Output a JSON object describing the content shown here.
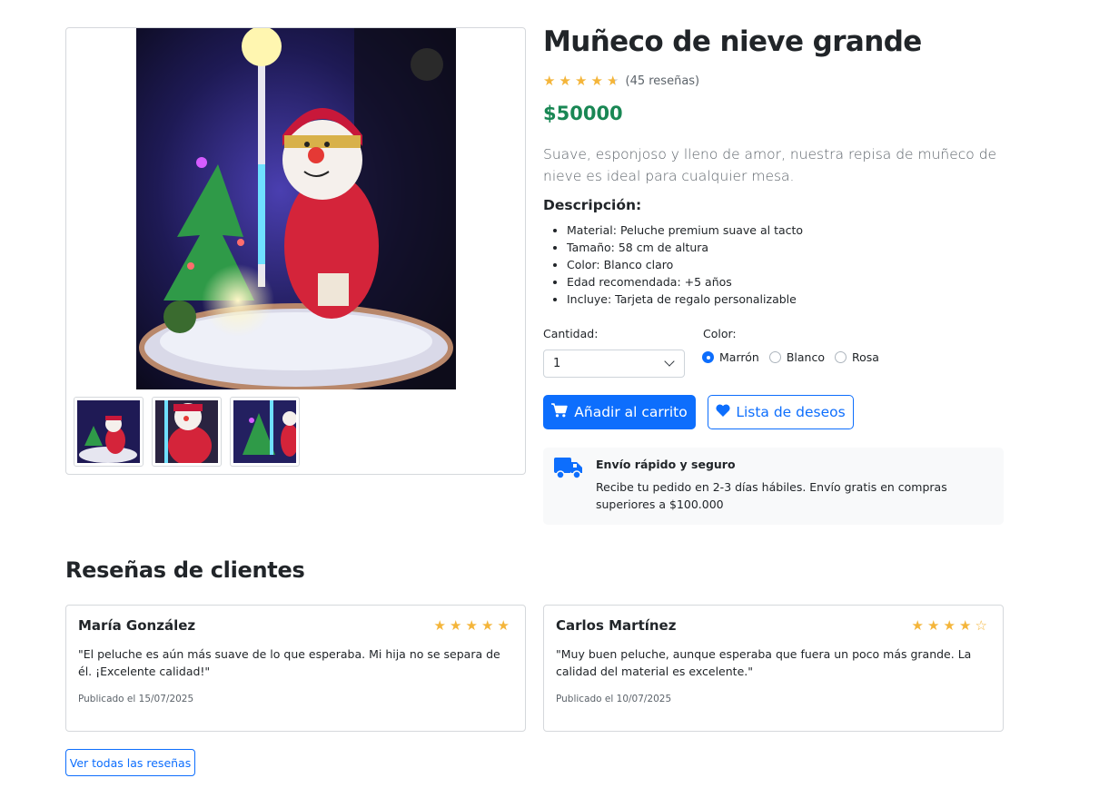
{
  "product": {
    "title": "Muñeco de nieve grande",
    "rating": 4.5,
    "reviews_count_text": "(45 reseñas)",
    "price": "$50000",
    "summary": "Suave, esponjoso y lleno de amor, nuestra repisa de muñeco de nieve es ideal para cualquier mesa.",
    "description_title": "Descripción:",
    "description_items": [
      "Material: Peluche premium suave al tacto",
      "Tamaño: 58 cm de altura",
      "Color: Blanco claro",
      "Edad recomendada: +5 años",
      "Incluye: Tarjeta de regalo personalizable"
    ]
  },
  "options": {
    "quantity_label": "Cantidad:",
    "quantity_value": "1",
    "color_label": "Color:",
    "colors": [
      "Marrón",
      "Blanco",
      "Rosa"
    ],
    "selected_color": "Marrón"
  },
  "actions": {
    "add_to_cart": "Añadir al carrito",
    "wishlist": "Lista de deseos"
  },
  "shipping": {
    "title": "Envío rápido y seguro",
    "text": "Recibe tu pedido en 2-3 días hábiles. Envío gratis en compras superiores a $100.000"
  },
  "reviews": {
    "title": "Reseñas de clientes",
    "items": [
      {
        "name": "María González",
        "rating": 5,
        "text": "\"El peluche es aún más suave de lo que esperaba. Mi hija no se separa de él. ¡Excelente calidad!\"",
        "date": "Publicado el 15/07/2025"
      },
      {
        "name": "Carlos Martínez",
        "rating": 4,
        "text": "\"Muy buen peluche, aunque esperaba que fuera un poco más grande. La calidad del material es excelente.\"",
        "date": "Publicado el 10/07/2025"
      }
    ],
    "view_all": "Ver todas las reseñas"
  },
  "colors": {
    "primary": "#0d6efd",
    "price": "#198754",
    "star": "#f4b53a"
  },
  "icons": {
    "cart": "cart-icon",
    "wishlist": "heart-icon",
    "shipping": "truck-icon",
    "star": "star-icon"
  }
}
